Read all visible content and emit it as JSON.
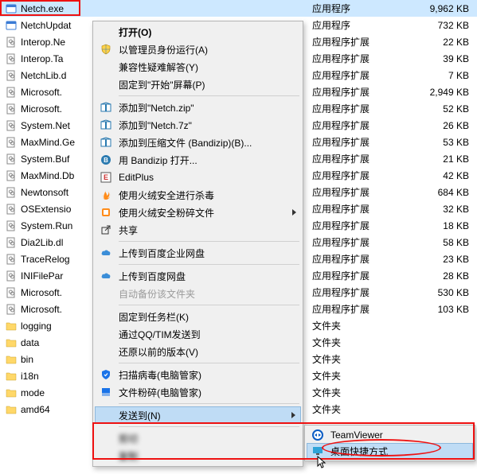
{
  "files": [
    {
      "name": "Netch.exe",
      "type": "应用程序",
      "size": "9,962 KB",
      "icon": "app",
      "selected": true
    },
    {
      "name": "NetchUpdat",
      "type": "应用程序",
      "size": "732 KB",
      "icon": "app"
    },
    {
      "name": "Interop.Ne",
      "type": "应用程序扩展",
      "size": "22 KB",
      "icon": "dll"
    },
    {
      "name": "Interop.Ta",
      "type": "应用程序扩展",
      "size": "39 KB",
      "icon": "dll"
    },
    {
      "name": "NetchLib.d",
      "type": "应用程序扩展",
      "size": "7 KB",
      "icon": "dll"
    },
    {
      "name": "Microsoft.",
      "type": "应用程序扩展",
      "size": "2,949 KB",
      "icon": "dll"
    },
    {
      "name": "Microsoft.",
      "type": "应用程序扩展",
      "size": "52 KB",
      "icon": "dll"
    },
    {
      "name": "System.Net",
      "type": "应用程序扩展",
      "size": "26 KB",
      "icon": "dll"
    },
    {
      "name": "MaxMind.Ge",
      "type": "应用程序扩展",
      "size": "53 KB",
      "icon": "dll"
    },
    {
      "name": "System.Buf",
      "type": "应用程序扩展",
      "size": "21 KB",
      "icon": "dll"
    },
    {
      "name": "MaxMind.Db",
      "type": "应用程序扩展",
      "size": "42 KB",
      "icon": "dll"
    },
    {
      "name": "Newtonsoft",
      "type": "应用程序扩展",
      "size": "684 KB",
      "icon": "dll"
    },
    {
      "name": "OSExtensio",
      "type": "应用程序扩展",
      "size": "32 KB",
      "icon": "dll"
    },
    {
      "name": "System.Run",
      "type": "应用程序扩展",
      "size": "18 KB",
      "icon": "dll"
    },
    {
      "name": "Dia2Lib.dl",
      "type": "应用程序扩展",
      "size": "58 KB",
      "icon": "dll"
    },
    {
      "name": "TraceRelog",
      "type": "应用程序扩展",
      "size": "23 KB",
      "icon": "dll"
    },
    {
      "name": "INIFilePar",
      "type": "应用程序扩展",
      "size": "28 KB",
      "icon": "dll"
    },
    {
      "name": "Microsoft.",
      "type": "应用程序扩展",
      "size": "530 KB",
      "icon": "dll"
    },
    {
      "name": "Microsoft.",
      "type": "应用程序扩展",
      "size": "103 KB",
      "icon": "dll"
    },
    {
      "name": "logging",
      "type": "文件夹",
      "size": "",
      "icon": "folder"
    },
    {
      "name": "data",
      "type": "文件夹",
      "size": "",
      "icon": "folder"
    },
    {
      "name": "bin",
      "type": "文件夹",
      "size": "",
      "icon": "folder"
    },
    {
      "name": "i18n",
      "type": "文件夹",
      "size": "",
      "icon": "folder"
    },
    {
      "name": "mode",
      "type": "文件夹",
      "size": "",
      "icon": "folder"
    },
    {
      "name": "amd64",
      "type": "文件夹",
      "size": "",
      "icon": "folder"
    }
  ],
  "menu": {
    "open": "打开(O)",
    "runas": "以管理员身份运行(A)",
    "compat": "兼容性疑难解答(Y)",
    "pin_start": "固定到\"开始\"屏幕(P)",
    "add_zip": "添加到\"Netch.zip\"",
    "add_7z": "添加到\"Netch.7z\"",
    "add_compress": "添加到压缩文件 (Bandizip)(B)...",
    "open_bandizip": "用 Bandizip 打开...",
    "editplus": "EditPlus",
    "huorong_scan": "使用火绒安全进行杀毒",
    "huorong_shred": "使用火绒安全粉碎文件",
    "share": "共享",
    "upload_baidu_ent": "上传到百度企业网盘",
    "upload_baidu": "上传到百度网盘",
    "auto_backup": "自动备份该文件夹",
    "pin_taskbar": "固定到任务栏(K)",
    "send_qq": "通过QQ/TIM发送到",
    "restore_prev": "还原以前的版本(V)",
    "scan_virus": "扫描病毒(电脑管家)",
    "file_shred": "文件粉碎(电脑管家)",
    "send_to": "发送到(N)",
    "cut_blur": "———",
    "copy_blur": "———"
  },
  "submenu": {
    "teamviewer": "TeamViewer",
    "desktop_shortcut": "桌面快捷方式"
  }
}
